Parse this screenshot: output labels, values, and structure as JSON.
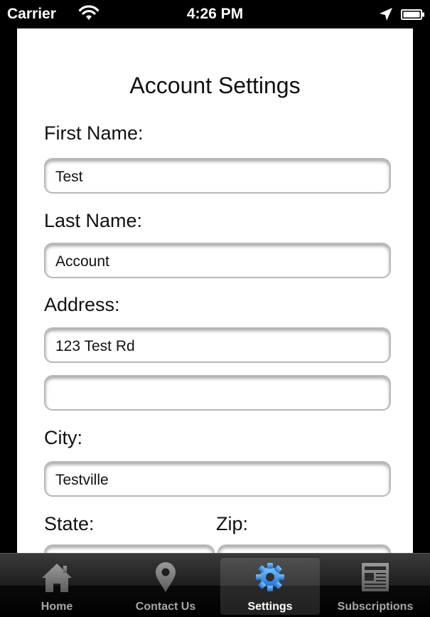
{
  "status_bar": {
    "carrier": "Carrier",
    "time": "4:26 PM",
    "icons": [
      "wifi-icon",
      "location-icon",
      "battery-icon"
    ]
  },
  "form": {
    "title": "Account Settings",
    "first_name": {
      "label": "First Name:",
      "value": "Test"
    },
    "last_name": {
      "label": "Last Name:",
      "value": "Account"
    },
    "address": {
      "label": "Address:",
      "line1": "123 Test Rd",
      "line2": ""
    },
    "city": {
      "label": "City:",
      "value": "Testville"
    },
    "state": {
      "label": "State:",
      "value": ""
    },
    "zip": {
      "label": "Zip:",
      "value": ""
    }
  },
  "tab_bar": {
    "active": "Settings",
    "active_color": "#2a8ee8",
    "tabs": [
      {
        "label": "Home",
        "icon": "home-icon"
      },
      {
        "label": "Contact Us",
        "icon": "map-pin-icon"
      },
      {
        "label": "Settings",
        "icon": "gear-icon"
      },
      {
        "label": "Subscriptions",
        "icon": "newspaper-icon"
      }
    ]
  }
}
